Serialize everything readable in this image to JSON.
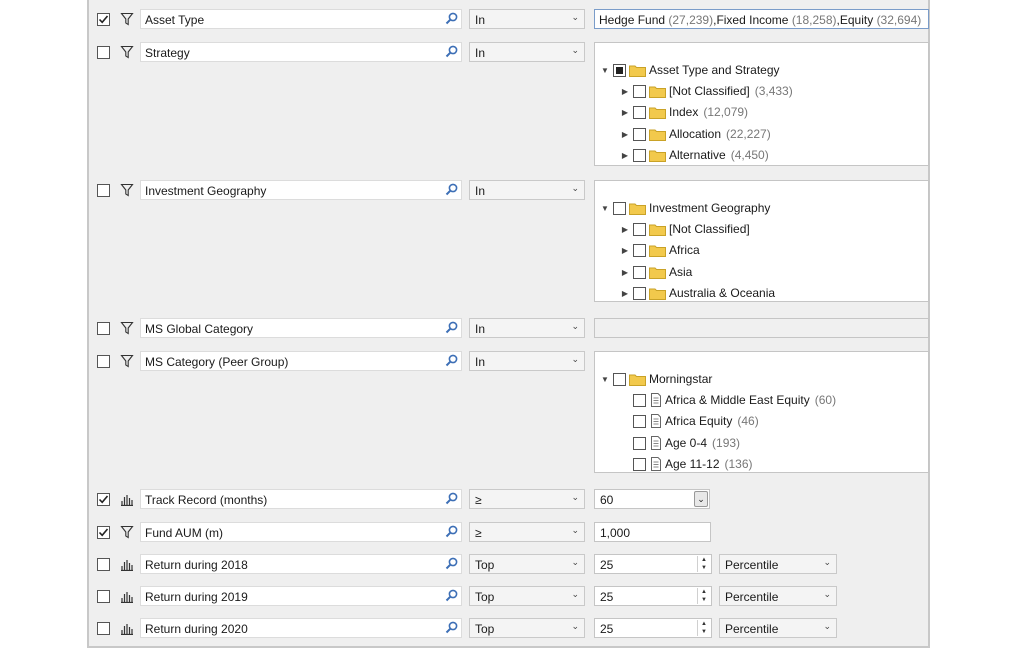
{
  "filters": [
    {
      "id": "asset_type",
      "checked": true,
      "kind": "filter",
      "label": "Asset Type",
      "operator": "In",
      "values": [
        {
          "name": "Hedge Fund",
          "count": "(27,239)"
        },
        {
          "name": "Fixed Income",
          "count": "(18,258)"
        },
        {
          "name": "Equity",
          "count": "(32,694)"
        }
      ]
    },
    {
      "id": "strategy",
      "checked": false,
      "kind": "filter",
      "label": "Strategy",
      "operator": "In",
      "tree": {
        "root": "Asset Type and Strategy",
        "root_state": "partial",
        "items": [
          {
            "label": "[Not Classified]",
            "count": "(3,433)"
          },
          {
            "label": "Index",
            "count": "(12,079)"
          },
          {
            "label": "Allocation",
            "count": "(22,227)"
          },
          {
            "label": "Alternative",
            "count": "(4,450)"
          }
        ]
      }
    },
    {
      "id": "geo",
      "checked": false,
      "kind": "filter",
      "label": "Investment Geography",
      "operator": "In",
      "tree": {
        "root": "Investment Geography",
        "root_state": "unchecked",
        "items": [
          {
            "label": "[Not Classified]",
            "count": ""
          },
          {
            "label": "Africa",
            "count": ""
          },
          {
            "label": "Asia",
            "count": ""
          },
          {
            "label": "Australia & Oceania",
            "count": ""
          }
        ]
      }
    },
    {
      "id": "ms_global",
      "checked": false,
      "kind": "filter",
      "label": "MS Global Category",
      "operator": "In"
    },
    {
      "id": "ms_cat",
      "checked": false,
      "kind": "filter",
      "label": "MS Category (Peer Group)",
      "operator": "In",
      "tree": {
        "root": "Morningstar",
        "root_state": "unchecked",
        "items": [
          {
            "label": "Africa & Middle East Equity",
            "count": "(60)"
          },
          {
            "label": "Africa Equity",
            "count": "(46)"
          },
          {
            "label": "Age 0-4",
            "count": "(193)"
          },
          {
            "label": "Age 11-12",
            "count": "(136)"
          }
        ]
      }
    },
    {
      "id": "track",
      "checked": true,
      "kind": "chart",
      "label": "Track Record (months)",
      "operator": "≥",
      "value": "60"
    },
    {
      "id": "aum",
      "checked": true,
      "kind": "filter",
      "label": "Fund AUM (m)",
      "operator": "≥",
      "value": "1,000"
    },
    {
      "id": "r2018",
      "checked": false,
      "kind": "chart",
      "label": "Return during 2018",
      "operator": "Top",
      "value": "25",
      "unit": "Percentile"
    },
    {
      "id": "r2019",
      "checked": false,
      "kind": "chart",
      "label": "Return during 2019",
      "operator": "Top",
      "value": "25",
      "unit": "Percentile"
    },
    {
      "id": "r2020",
      "checked": false,
      "kind": "chart",
      "label": "Return during 2020",
      "operator": "Top",
      "value": "25",
      "unit": "Percentile"
    }
  ],
  "colors": {
    "panel": "#efefef",
    "folder": "#f2c94c",
    "folder_edge": "#c9a227",
    "search": "#3d6fb6"
  }
}
